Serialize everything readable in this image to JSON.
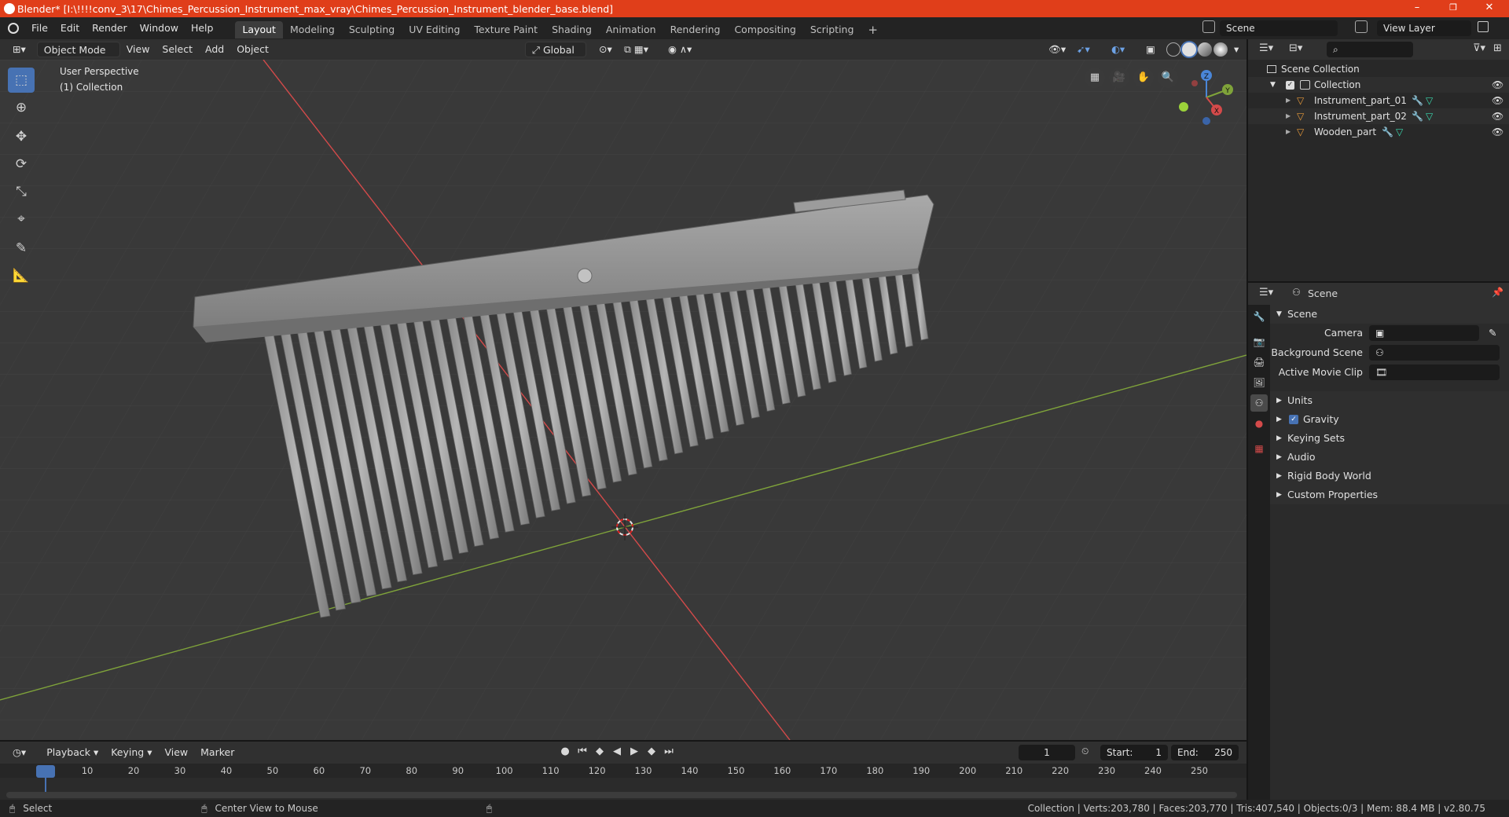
{
  "titlebar": {
    "title": "Blender* [I:\\!!!!conv_3\\17\\Chimes_Percussion_Instrument_max_vray\\Chimes_Percussion_Instrument_blender_base.blend]",
    "minimize": "–",
    "maximize": "❐",
    "close": "✕"
  },
  "menus": [
    "File",
    "Edit",
    "Render",
    "Window",
    "Help"
  ],
  "workspaces": [
    "Layout",
    "Modeling",
    "Sculpting",
    "UV Editing",
    "Texture Paint",
    "Shading",
    "Animation",
    "Rendering",
    "Compositing",
    "Scripting"
  ],
  "workspace_add": "+",
  "scene_field": "Scene",
  "view_layer_field": "View Layer",
  "viewport_header": {
    "mode": "Object Mode",
    "view": "View",
    "select": "Select",
    "add": "Add",
    "object": "Object",
    "transform": "Global"
  },
  "overlay_text": {
    "perspective": "User Perspective",
    "collection": "(1) Collection"
  },
  "gizmo": {
    "x": "X",
    "y": "Y",
    "z": "Z"
  },
  "outliner": {
    "scene_collection": "Scene Collection",
    "collection": "Collection",
    "items": [
      "Instrument_part_01",
      "Instrument_part_02",
      "Wooden_part"
    ]
  },
  "properties": {
    "header": "Scene",
    "section": "Scene",
    "camera_label": "Camera",
    "bg_scene_label": "Background Scene",
    "movie_clip_label": "Active Movie Clip",
    "panels": [
      "Units",
      "Gravity",
      "Keying Sets",
      "Audio",
      "Rigid Body World",
      "Custom Properties"
    ]
  },
  "timeline": {
    "playback": "Playback",
    "keying": "Keying",
    "view": "View",
    "marker": "Marker",
    "current_frame": "1",
    "start_label": "Start:",
    "start": "1",
    "end_label": "End:",
    "end": "250",
    "ticks": [
      "1",
      "10",
      "20",
      "30",
      "40",
      "50",
      "60",
      "70",
      "80",
      "90",
      "100",
      "110",
      "120",
      "130",
      "140",
      "150",
      "160",
      "170",
      "180",
      "190",
      "200",
      "210",
      "220",
      "230",
      "240",
      "250"
    ]
  },
  "statusbar": {
    "select": "Select",
    "center_view": "Center View to Mouse",
    "stats": "Collection | Verts:203,780 | Faces:203,770 | Tris:407,540 | Objects:0/3 | Mem: 88.4 MB | v2.80.75"
  },
  "colors": {
    "accent": "#4772b3",
    "titlebar": "#e03e1a",
    "x_axis": "#d44a4a",
    "y_axis": "#7fa33a"
  }
}
